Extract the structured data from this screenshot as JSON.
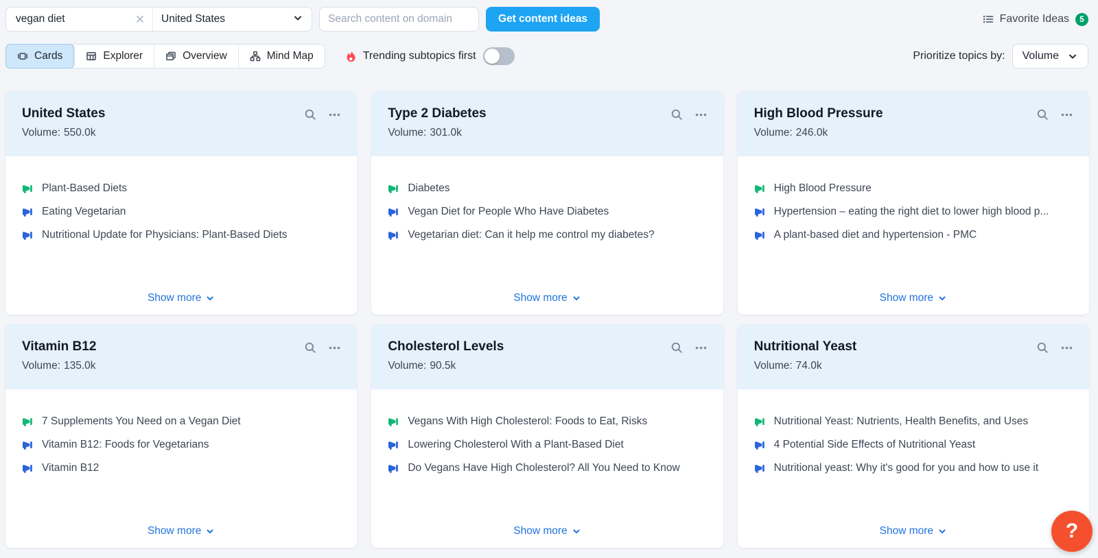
{
  "toolbar": {
    "keyword_input": {
      "value": "vegan diet"
    },
    "country_select": {
      "value": "United States"
    },
    "domain_input": {
      "placeholder": "Search content on domain"
    },
    "get_ideas_button": "Get content ideas",
    "favorite_ideas": {
      "label": "Favorite Ideas",
      "count": "5"
    }
  },
  "view_bar": {
    "tabs": [
      {
        "label": "Cards",
        "icon": "cards-icon",
        "selected": true
      },
      {
        "label": "Explorer",
        "icon": "table-icon",
        "selected": false
      },
      {
        "label": "Overview",
        "icon": "overview-icon",
        "selected": false
      },
      {
        "label": "Mind Map",
        "icon": "mindmap-icon",
        "selected": false
      }
    ],
    "trending": {
      "label": "Trending subtopics first",
      "icon": "fire-icon",
      "toggle_on": false
    },
    "prioritize": {
      "label": "Prioritize topics by:",
      "value": "Volume"
    }
  },
  "labels": {
    "volume": "Volume:",
    "show_more": "Show more"
  },
  "cards": [
    {
      "title": "United States",
      "volume": "550.0k",
      "items": [
        {
          "text": "Plant-Based Diets",
          "trending": true
        },
        {
          "text": "Eating Vegetarian",
          "trending": false
        },
        {
          "text": "Nutritional Update for Physicians: Plant-Based Diets",
          "trending": false
        }
      ]
    },
    {
      "title": "Type 2 Diabetes",
      "volume": "301.0k",
      "items": [
        {
          "text": "Diabetes",
          "trending": true
        },
        {
          "text": "Vegan Diet for People Who Have Diabetes",
          "trending": false
        },
        {
          "text": "Vegetarian diet: Can it help me control my diabetes?",
          "trending": false
        }
      ]
    },
    {
      "title": "High Blood Pressure",
      "volume": "246.0k",
      "items": [
        {
          "text": "High Blood Pressure",
          "trending": true
        },
        {
          "text": "Hypertension – eating the right diet to lower high blood p...",
          "trending": false
        },
        {
          "text": "A plant-based diet and hypertension - PMC",
          "trending": false
        }
      ]
    },
    {
      "title": "Vitamin B12",
      "volume": "135.0k",
      "items": [
        {
          "text": "7 Supplements You Need on a Vegan Diet",
          "trending": true
        },
        {
          "text": "Vitamin B12: Foods for Vegetarians",
          "trending": false
        },
        {
          "text": "Vitamin B12",
          "trending": false
        }
      ]
    },
    {
      "title": "Cholesterol Levels",
      "volume": "90.5k",
      "items": [
        {
          "text": "Vegans With High Cholesterol: Foods to Eat, Risks",
          "trending": true
        },
        {
          "text": "Lowering Cholesterol With a Plant-Based Diet",
          "trending": false
        },
        {
          "text": "Do Vegans Have High Cholesterol? All You Need to Know",
          "trending": false
        }
      ]
    },
    {
      "title": "Nutritional Yeast",
      "volume": "74.0k",
      "items": [
        {
          "text": "Nutritional Yeast: Nutrients, Health Benefits, and Uses",
          "trending": true
        },
        {
          "text": "4 Potential Side Effects of Nutritional Yeast",
          "trending": false
        },
        {
          "text": "Nutritional yeast: Why it's good for you and how to use it",
          "trending": false
        }
      ]
    }
  ],
  "help_button": "?",
  "colors": {
    "accent_blue": "#1da4f2",
    "link_blue": "#2173dd",
    "megaphone_green": "#10b878",
    "megaphone_blue": "#2a63dc",
    "card_header_bg": "#e5f1fb",
    "selected_tab_bg": "#cfe7fb",
    "fire_red": "#ff4b55",
    "badge_green": "#00a06b",
    "help_orange": "#f4502e"
  }
}
